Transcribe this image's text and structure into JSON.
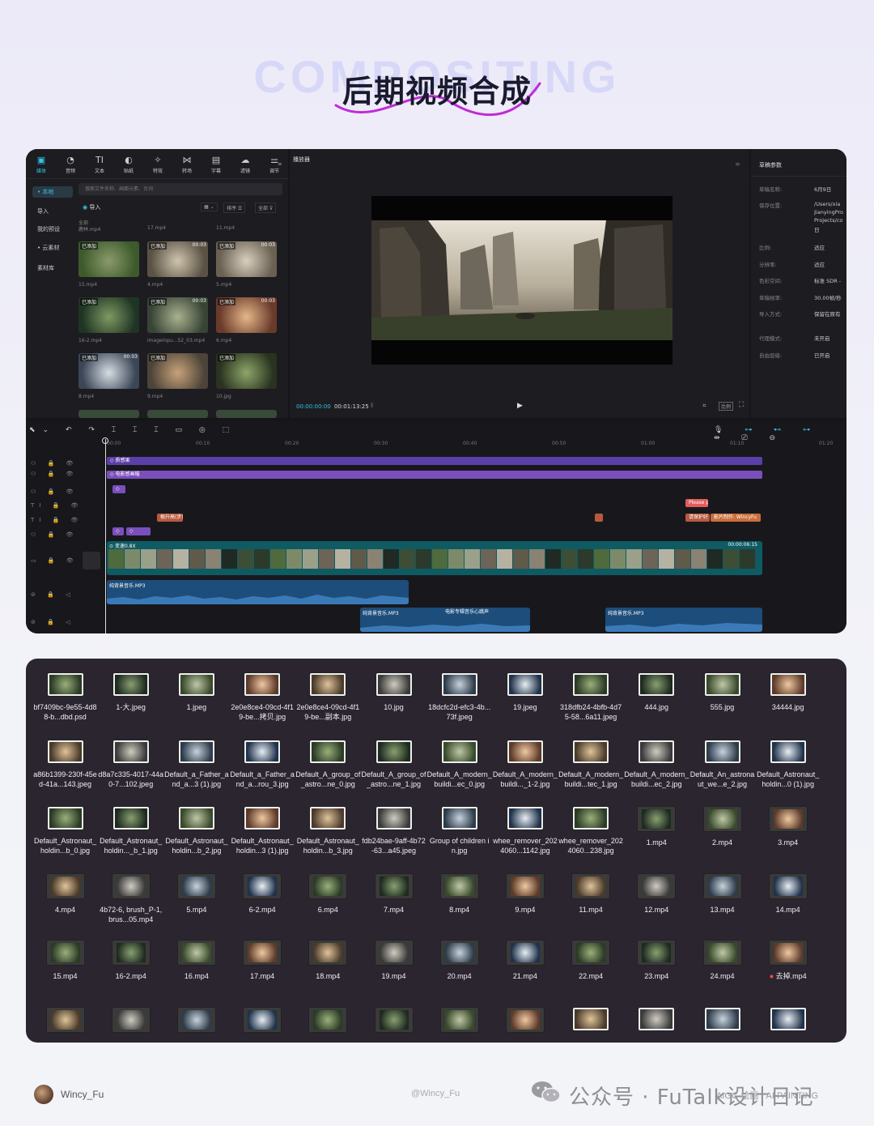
{
  "header": {
    "bg_word": "COMPOSITING",
    "title": "后期视频合成"
  },
  "editor": {
    "toolbar": [
      {
        "icon": "media-icon",
        "glyph": "▣",
        "label": "媒体",
        "active": true
      },
      {
        "icon": "audio-icon",
        "glyph": "◔",
        "label": "音频"
      },
      {
        "icon": "text-icon",
        "glyph": "TI",
        "label": "文本"
      },
      {
        "icon": "sticker-icon",
        "glyph": "◐",
        "label": "贴纸"
      },
      {
        "icon": "effects-icon",
        "glyph": "✧",
        "label": "特效"
      },
      {
        "icon": "transition-icon",
        "glyph": "⋈",
        "label": "转场"
      },
      {
        "icon": "caption-icon",
        "glyph": "▤",
        "label": "字幕"
      },
      {
        "icon": "filter-icon",
        "glyph": "☁",
        "label": "滤镜"
      },
      {
        "icon": "adjust-icon",
        "glyph": "⚌",
        "label": "调节"
      }
    ],
    "sidebar": [
      {
        "label": "• 本地",
        "active": true
      },
      {
        "label": "导入"
      },
      {
        "label": "我的预设"
      },
      {
        "label": "• 云素材"
      },
      {
        "label": "素材库"
      }
    ],
    "search_placeholder": "搜索文件名称、画面元素、台词",
    "import_label": "导入",
    "sort_label": "排序",
    "all_label": "全部",
    "all_small": "全部",
    "media": [
      {
        "top_name": "鹿林.mp4",
        "caption": "15.mp4",
        "tag": "已添加",
        "dur": ""
      },
      {
        "top_name": "17.mp4",
        "caption": "4.mp4",
        "tag": "已添加",
        "dur": "00:03"
      },
      {
        "top_name": "11.mp4",
        "caption": "5.mp4",
        "tag": "已添加",
        "dur": "00:03"
      },
      {
        "caption": "16-2.mp4",
        "tag": "已添加",
        "dur": ""
      },
      {
        "caption": "imageinpu...52_03.mp4",
        "tag": "已添加",
        "dur": "00:03"
      },
      {
        "caption": "6.mp4",
        "tag": "已添加",
        "dur": "00:03"
      },
      {
        "caption": "8.mp4",
        "tag": "已添加",
        "dur": "00:03"
      },
      {
        "caption": "9.mp4",
        "tag": "已添加",
        "dur": ""
      },
      {
        "caption": "10.jpg",
        "tag": "已添加",
        "dur": ""
      }
    ],
    "player": {
      "title": "播放器",
      "current_time": "00:00:00:00",
      "total_time": "00:01:13:25"
    },
    "properties": {
      "title": "草稿参数",
      "rows": [
        {
          "label": "草稿名称:",
          "value": "6月9日"
        },
        {
          "label": "保存位置:",
          "value": "/Users/xia"
        },
        {
          "label": "",
          "value": "JianyingPro"
        },
        {
          "label": "",
          "value": "Projects/co"
        },
        {
          "label": "",
          "value": "日"
        },
        {
          "label": "比例:",
          "value": "适应"
        },
        {
          "label": "分辨率:",
          "value": "适应"
        },
        {
          "label": "色彩空间:",
          "value": "标准 SDR -"
        },
        {
          "label": "草稿帧率:",
          "value": "30.00帧/秒"
        },
        {
          "label": "导入方式:",
          "value": "保留在原有"
        },
        {
          "label": "代理模式:",
          "value": "未开启"
        },
        {
          "label": "自由层级:",
          "value": "已开启"
        }
      ]
    },
    "ruler": [
      "00:00",
      "00:10",
      "00:20",
      "00:30",
      "00:40",
      "00:50",
      "01:00",
      "01:10",
      "01:20"
    ],
    "tracks": {
      "fx1": "质感果",
      "fx2": "电影感画幅",
      "note": "Please p",
      "text_a": "根升高(步)",
      "text_b": "请保护好",
      "text_c": "影片制作: WincyFu",
      "main_clip": "变速0.8X",
      "main_time": "00:00:06:15",
      "audio1": "纯背景音乐.MP3",
      "audio2": "纯背景音乐.MP3",
      "audio3": "纯背景音乐.MP3",
      "audio4": "电影专辑音乐心跳声"
    }
  },
  "gallery": {
    "items": [
      {
        "name": "bf7409bc-9e55-4d88-b...dbd.psd",
        "kind": "img"
      },
      {
        "name": "1-大.jpeg",
        "kind": "img"
      },
      {
        "name": "1.jpeg",
        "kind": "img"
      },
      {
        "name": "2e0e8ce4-09cd-4f19-be...拷贝.jpg",
        "kind": "img"
      },
      {
        "name": "2e0e8ce4-09cd-4f19-be...副本.jpg",
        "kind": "img"
      },
      {
        "name": "10.jpg",
        "kind": "img"
      },
      {
        "name": "18dcfc2d-efc3-4b...73f.jpeg",
        "kind": "img"
      },
      {
        "name": "19.jpeg",
        "kind": "img"
      },
      {
        "name": "318dfb24-4bfb-4d75-58...6a11.jpeg",
        "kind": "img"
      },
      {
        "name": "444.jpg",
        "kind": "img"
      },
      {
        "name": "555.jpg",
        "kind": "img"
      },
      {
        "name": "34444.jpg",
        "kind": "img"
      },
      {
        "name": "a86b1399-230f-45ed-41a...143.jpeg",
        "kind": "img"
      },
      {
        "name": "d8a7c335-4017-44a0-7...102.jpeg",
        "kind": "img"
      },
      {
        "name": "Default_a_Father_and_a...3 (1).jpg",
        "kind": "img"
      },
      {
        "name": "Default_a_Father_and_a...rou_3.jpg",
        "kind": "img"
      },
      {
        "name": "Default_A_group_of_astro...ne_0.jpg",
        "kind": "img"
      },
      {
        "name": "Default_A_group_of_astro...ne_1.jpg",
        "kind": "img"
      },
      {
        "name": "Default_A_modern_buildi...ec_0.jpg",
        "kind": "img"
      },
      {
        "name": "Default_A_modern_buildi..._1-2.jpg",
        "kind": "img"
      },
      {
        "name": "Default_A_modern_buildi...tec_1.jpg",
        "kind": "img"
      },
      {
        "name": "Default_A_modern_buildi...ec_2.jpg",
        "kind": "img"
      },
      {
        "name": "Default_An_astronaut_we...e_2.jpg",
        "kind": "img"
      },
      {
        "name": "Default_Astronaut_holdin...0 (1).jpg",
        "kind": "img"
      },
      {
        "name": "Default_Astronaut_holdin...b_0.jpg",
        "kind": "img"
      },
      {
        "name": "Default_Astronaut_holdin..._b_1.jpg",
        "kind": "img"
      },
      {
        "name": "Default_Astronaut_holdin...b_2.jpg",
        "kind": "img"
      },
      {
        "name": "Default_Astronaut_holdin...3 (1).jpg",
        "kind": "img"
      },
      {
        "name": "Default_Astronaut_holdin...b_3.jpg",
        "kind": "img"
      },
      {
        "name": "fdb24bae-9aff-4b72-63...a45.jpeg",
        "kind": "img"
      },
      {
        "name": "Group of children in.jpg",
        "kind": "img"
      },
      {
        "name": "whee_remover_2024060...1142.jpg",
        "kind": "img"
      },
      {
        "name": "whee_remover_2024060...238.jpg",
        "kind": "img"
      },
      {
        "name": "1.mp4",
        "kind": "vid"
      },
      {
        "name": "2.mp4",
        "kind": "vid"
      },
      {
        "name": "3.mp4",
        "kind": "vid"
      },
      {
        "name": "4.mp4",
        "kind": "vid"
      },
      {
        "name": "4b72-6, brush_P-1, brus...05.mp4",
        "kind": "vid"
      },
      {
        "name": "5.mp4",
        "kind": "vid"
      },
      {
        "name": "6-2.mp4",
        "kind": "vid"
      },
      {
        "name": "6.mp4",
        "kind": "vid"
      },
      {
        "name": "7.mp4",
        "kind": "vid"
      },
      {
        "name": "8.mp4",
        "kind": "vid"
      },
      {
        "name": "9.mp4",
        "kind": "vid"
      },
      {
        "name": "11.mp4",
        "kind": "vid"
      },
      {
        "name": "12.mp4",
        "kind": "vid"
      },
      {
        "name": "13.mp4",
        "kind": "vid"
      },
      {
        "name": "14.mp4",
        "kind": "vid"
      },
      {
        "name": "15.mp4",
        "kind": "vid"
      },
      {
        "name": "16-2.mp4",
        "kind": "vid"
      },
      {
        "name": "16.mp4",
        "kind": "vid"
      },
      {
        "name": "17.mp4",
        "kind": "vid"
      },
      {
        "name": "18.mp4",
        "kind": "vid"
      },
      {
        "name": "19.mp4",
        "kind": "vid"
      },
      {
        "name": "20.mp4",
        "kind": "vid"
      },
      {
        "name": "21.mp4",
        "kind": "vid"
      },
      {
        "name": "22.mp4",
        "kind": "vid"
      },
      {
        "name": "23.mp4",
        "kind": "vid"
      },
      {
        "name": "24.mp4",
        "kind": "vid"
      },
      {
        "name": "去掉.mp4",
        "kind": "vid",
        "dot": true
      },
      {
        "name": "",
        "kind": "vid"
      },
      {
        "name": "",
        "kind": "vid"
      },
      {
        "name": "",
        "kind": "vid"
      },
      {
        "name": "",
        "kind": "vid"
      },
      {
        "name": "",
        "kind": "vid"
      },
      {
        "name": "",
        "kind": "vid"
      },
      {
        "name": "",
        "kind": "vid"
      },
      {
        "name": "",
        "kind": "vid"
      },
      {
        "name": "",
        "kind": "img"
      },
      {
        "name": "",
        "kind": "img"
      },
      {
        "name": "",
        "kind": "img"
      },
      {
        "name": "",
        "kind": "img"
      }
    ]
  },
  "footer": {
    "author": "Wincy_Fu",
    "handle": "@Wincy_Fu",
    "watermark": "公众号 · FuTalk设计日记",
    "watermark_small": "AIGC·绘画 | AI PAINTING"
  },
  "colors": {
    "accent": "#34c3e5",
    "fx_track": "#5b3fa8",
    "fx_track2": "#7a4fbb",
    "audio_track": "#1d4d7a",
    "main_track": "#0e5b63",
    "gallery_bg": "#2b2530"
  }
}
